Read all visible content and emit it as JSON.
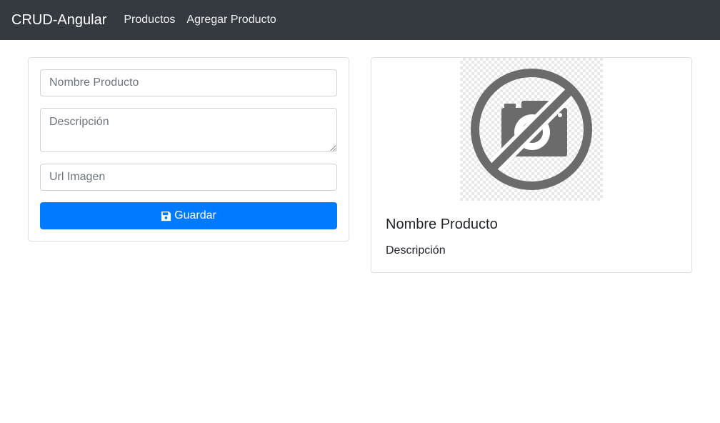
{
  "navbar": {
    "brand": "CRUD-Angular",
    "links": [
      {
        "label": "Productos"
      },
      {
        "label": "Agregar Producto"
      }
    ],
    "background": "#343a40"
  },
  "form": {
    "nombre_placeholder": "Nombre Producto",
    "descripcion_placeholder": "Descripción",
    "url_placeholder": "Url Imagen",
    "save_label": "Guardar",
    "save_icon": "floppy-disk-icon",
    "button_color": "#007bff"
  },
  "preview": {
    "image_icon": "no-camera-icon",
    "title": "Nombre Producto",
    "description": "Descripción"
  }
}
